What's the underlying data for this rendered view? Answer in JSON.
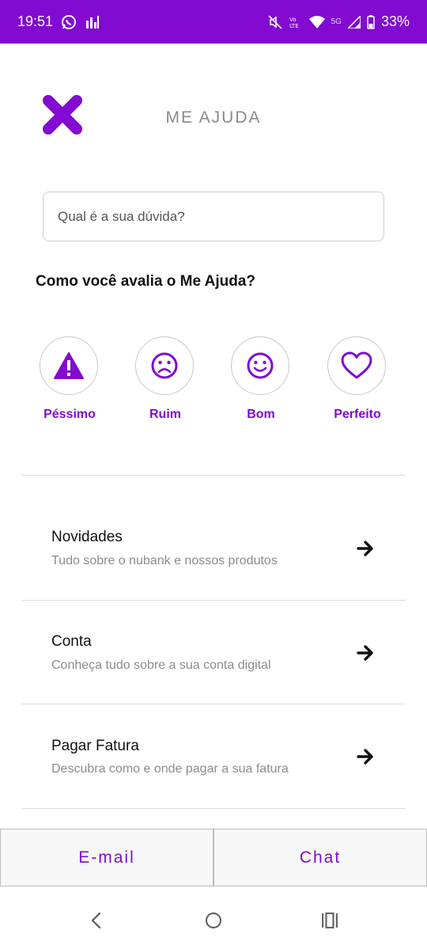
{
  "status_bar": {
    "time": "19:51",
    "battery": "33%",
    "network": "5G",
    "icons": [
      "whatsapp-icon",
      "signal-bars-icon",
      "mute-icon",
      "volte-icon",
      "wifi-icon",
      "cell-signal-icon",
      "battery-icon"
    ]
  },
  "header": {
    "title": "ME AJUDA",
    "close_icon": "close-icon",
    "accent_color": "#820ad1"
  },
  "search": {
    "placeholder": "Qual é a sua dúvida?"
  },
  "rating": {
    "question": "Como você avalia o Me Ajuda?",
    "options": [
      {
        "label": "Péssimo",
        "icon": "warning-icon"
      },
      {
        "label": "Ruim",
        "icon": "sad-face-icon"
      },
      {
        "label": "Bom",
        "icon": "smile-face-icon"
      },
      {
        "label": "Perfeito",
        "icon": "heart-icon"
      }
    ]
  },
  "menu": {
    "items": [
      {
        "title": "Novidades",
        "subtitle": "Tudo sobre o nubank e nossos produtos",
        "icon": "arrow-right-icon"
      },
      {
        "title": "Conta",
        "subtitle": "Conheça tudo sobre a sua conta digital",
        "icon": "arrow-right-icon"
      },
      {
        "title": "Pagar Fatura",
        "subtitle": "Descubra como e onde pagar a sua fatura",
        "icon": "arrow-right-icon"
      }
    ]
  },
  "footer": {
    "email_label": "E-mail",
    "chat_label": "Chat"
  },
  "nav_bar": {
    "icons": [
      "back-icon",
      "home-icon",
      "recents-icon"
    ]
  }
}
